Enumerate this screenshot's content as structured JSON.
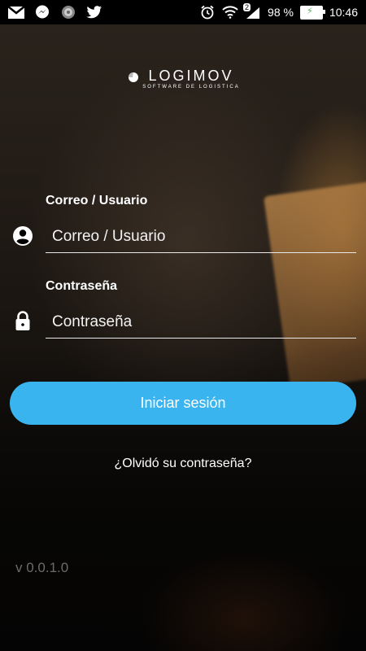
{
  "status_bar": {
    "icons": [
      "gmail-icon",
      "messenger-icon",
      "circle-app-icon",
      "twitter-icon"
    ],
    "right_icons": [
      "alarm-icon",
      "wifi-icon",
      "signal-icon",
      "battery-icon"
    ],
    "notification_count": "2",
    "battery": "98 %",
    "time": "10:46"
  },
  "logo": {
    "brand": "LOGIMOV",
    "tagline": "SOFTWARE DE LOGISTICA"
  },
  "form": {
    "user_label": "Correo / Usuario",
    "user_placeholder": "Correo / Usuario",
    "password_label": "Contraseña",
    "password_placeholder": "Contraseña",
    "submit_label": "Iniciar sesión",
    "forgot_label": "¿Olvidó su contraseña?"
  },
  "version": "v 0.0.1.0",
  "colors": {
    "accent": "#3ab4ee",
    "text": "#ffffff",
    "version_text": "#6b6b6b"
  }
}
